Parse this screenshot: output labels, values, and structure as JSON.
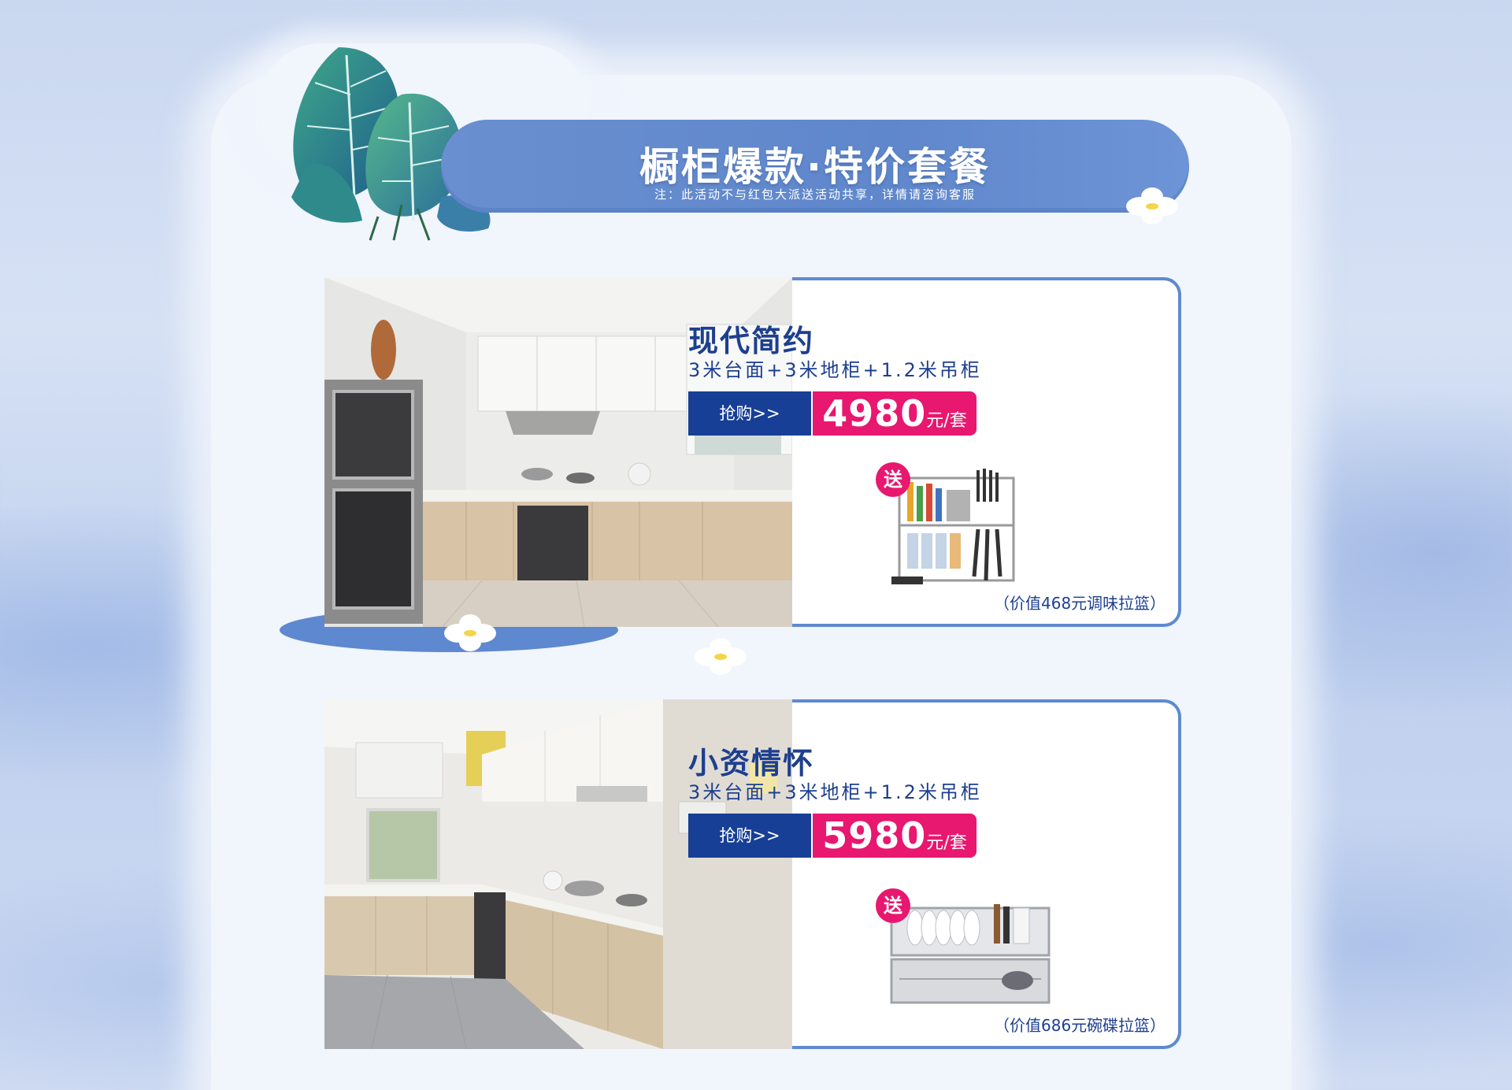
{
  "banner": {
    "title": "橱柜爆款·特价套餐",
    "note": "注：此活动不与红包大派送活动共享，详情请咨询客服"
  },
  "products": [
    {
      "name": "现代简约",
      "spec": "3米台面+3米地柜+1.2米吊柜",
      "buy_label": "抢购>>",
      "price": "4980",
      "price_unit": "元/套",
      "gift_badge": "送",
      "gift_value": "（价值468元调味拉篮）"
    },
    {
      "name": "小资情怀",
      "spec": "3米台面+3米地柜+1.2米吊柜",
      "buy_label": "抢购>>",
      "price": "5980",
      "price_unit": "元/套",
      "gift_badge": "送",
      "gift_value": "（价值686元碗碟拉篮）"
    }
  ],
  "colors": {
    "accent_blue": "#5f8ad0",
    "title_blue": "#1d3f8f",
    "buy_button": "#173f96",
    "price_pink": "#e8176f"
  },
  "icons": [
    "leaf-decoration-icon",
    "flower-icon",
    "kitchen-photo",
    "seasoning-rack-image",
    "dish-rack-image"
  ]
}
